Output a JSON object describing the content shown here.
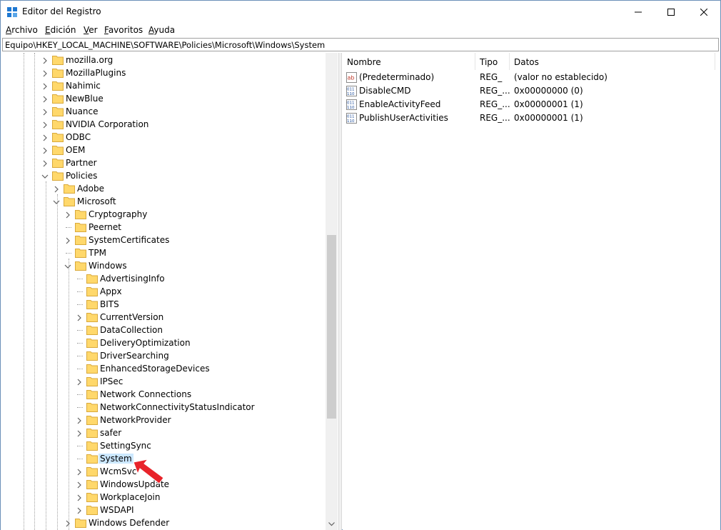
{
  "window": {
    "title": "Editor del Registro"
  },
  "menu": [
    {
      "label": "Archivo",
      "u": "A",
      "rest": "rchivo"
    },
    {
      "label": "Edición",
      "u": "E",
      "rest": "dición"
    },
    {
      "label": "Ver",
      "u": "V",
      "rest": "er"
    },
    {
      "label": "Favoritos",
      "u": "F",
      "rest": "avoritos"
    },
    {
      "label": "Ayuda",
      "u": "A",
      "rest": "yuda"
    }
  ],
  "address": "Equipo\\HKEY_LOCAL_MACHINE\\SOFTWARE\\Policies\\Microsoft\\Windows\\System",
  "tree": [
    {
      "label": "mozilla.org",
      "level": 0,
      "chev": "right"
    },
    {
      "label": "MozillaPlugins",
      "level": 0,
      "chev": "right"
    },
    {
      "label": "Nahimic",
      "level": 0,
      "chev": "right"
    },
    {
      "label": "NewBlue",
      "level": 0,
      "chev": "right"
    },
    {
      "label": "Nuance",
      "level": 0,
      "chev": "right"
    },
    {
      "label": "NVIDIA Corporation",
      "level": 0,
      "chev": "right"
    },
    {
      "label": "ODBC",
      "level": 0,
      "chev": "right"
    },
    {
      "label": "OEM",
      "level": 0,
      "chev": "right"
    },
    {
      "label": "Partner",
      "level": 0,
      "chev": "right"
    },
    {
      "label": "Policies",
      "level": 0,
      "chev": "down"
    },
    {
      "label": "Adobe",
      "level": 1,
      "chev": "right"
    },
    {
      "label": "Microsoft",
      "level": 1,
      "chev": "down"
    },
    {
      "label": "Cryptography",
      "level": 2,
      "chev": "right"
    },
    {
      "label": "Peernet",
      "level": 2,
      "chev": "none"
    },
    {
      "label": "SystemCertificates",
      "level": 2,
      "chev": "right"
    },
    {
      "label": "TPM",
      "level": 2,
      "chev": "none"
    },
    {
      "label": "Windows",
      "level": 2,
      "chev": "down"
    },
    {
      "label": "AdvertisingInfo",
      "level": 3,
      "chev": "none"
    },
    {
      "label": "Appx",
      "level": 3,
      "chev": "none"
    },
    {
      "label": "BITS",
      "level": 3,
      "chev": "none"
    },
    {
      "label": "CurrentVersion",
      "level": 3,
      "chev": "right"
    },
    {
      "label": "DataCollection",
      "level": 3,
      "chev": "none"
    },
    {
      "label": "DeliveryOptimization",
      "level": 3,
      "chev": "none"
    },
    {
      "label": "DriverSearching",
      "level": 3,
      "chev": "none"
    },
    {
      "label": "EnhancedStorageDevices",
      "level": 3,
      "chev": "none"
    },
    {
      "label": "IPSec",
      "level": 3,
      "chev": "right"
    },
    {
      "label": "Network Connections",
      "level": 3,
      "chev": "none"
    },
    {
      "label": "NetworkConnectivityStatusIndicator",
      "level": 3,
      "chev": "none"
    },
    {
      "label": "NetworkProvider",
      "level": 3,
      "chev": "right"
    },
    {
      "label": "safer",
      "level": 3,
      "chev": "right"
    },
    {
      "label": "SettingSync",
      "level": 3,
      "chev": "none"
    },
    {
      "label": "System",
      "level": 3,
      "chev": "none",
      "selected": true
    },
    {
      "label": "WcmSvc",
      "level": 3,
      "chev": "right"
    },
    {
      "label": "WindowsUpdate",
      "level": 3,
      "chev": "right"
    },
    {
      "label": "WorkplaceJoin",
      "level": 3,
      "chev": "right"
    },
    {
      "label": "WSDAPI",
      "level": 3,
      "chev": "right"
    },
    {
      "label": "Windows Defender",
      "level": 2,
      "chev": "right"
    }
  ],
  "columns": {
    "name": "Nombre",
    "type": "Tipo",
    "data": "Datos"
  },
  "values": [
    {
      "icon": "string-value-icon",
      "name": "(Predeterminado)",
      "type": "REG_",
      "data": "(valor no establecido)"
    },
    {
      "icon": "dword-value-icon",
      "name": "DisableCMD",
      "type": "REG_...",
      "data": "0x00000000 (0)"
    },
    {
      "icon": "dword-value-icon",
      "name": "EnableActivityFeed",
      "type": "REG_...",
      "data": "0x00000001 (1)"
    },
    {
      "icon": "dword-value-icon",
      "name": "PublishUserActivities",
      "type": "REG_...",
      "data": "0x00000001 (1)"
    }
  ],
  "colors": {
    "folder": "#ffd86b",
    "selection": "#cce8ff",
    "arrow": "#e8232a"
  }
}
